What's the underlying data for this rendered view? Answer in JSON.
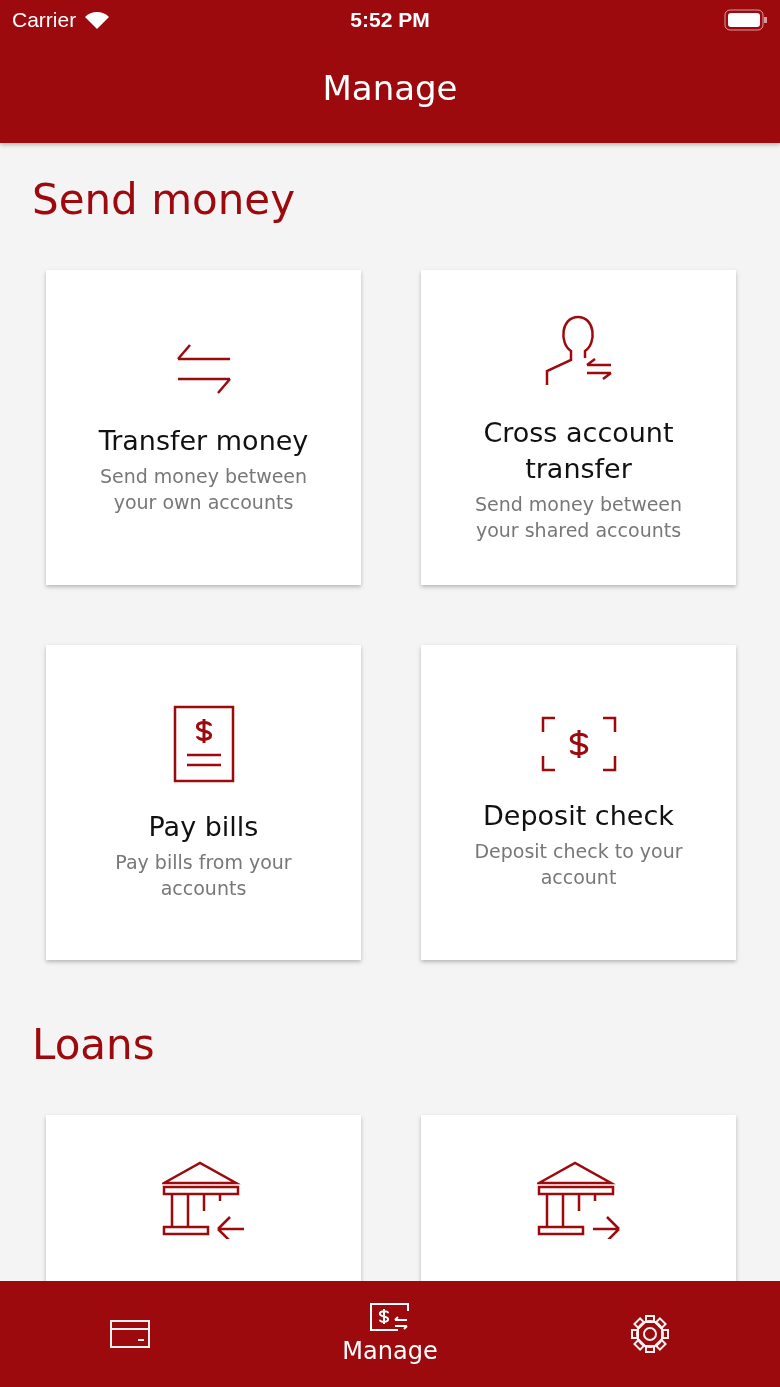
{
  "status_bar": {
    "carrier": "Carrier",
    "time": "5:52 PM"
  },
  "header": {
    "title": "Manage"
  },
  "sections": [
    {
      "title": "Send money",
      "cards": [
        {
          "kind": "transfer",
          "title": "Transfer money",
          "subtitle": "Send money between your own accounts"
        },
        {
          "kind": "person-transfer",
          "title": "Cross account transfer",
          "subtitle": "Send money between your shared accounts"
        },
        {
          "kind": "bill",
          "title": "Pay bills",
          "subtitle": "Pay bills from your accounts"
        },
        {
          "kind": "check",
          "title": "Deposit check",
          "subtitle": "Deposit check to your account"
        }
      ]
    },
    {
      "title": "Loans",
      "cards": [
        {
          "kind": "bank-in"
        },
        {
          "kind": "bank-out"
        }
      ]
    }
  ],
  "tab_bar": [
    {
      "kind": "accounts",
      "selected": false
    },
    {
      "kind": "manage",
      "label": "Manage",
      "selected": true
    },
    {
      "kind": "settings",
      "selected": false
    }
  ]
}
